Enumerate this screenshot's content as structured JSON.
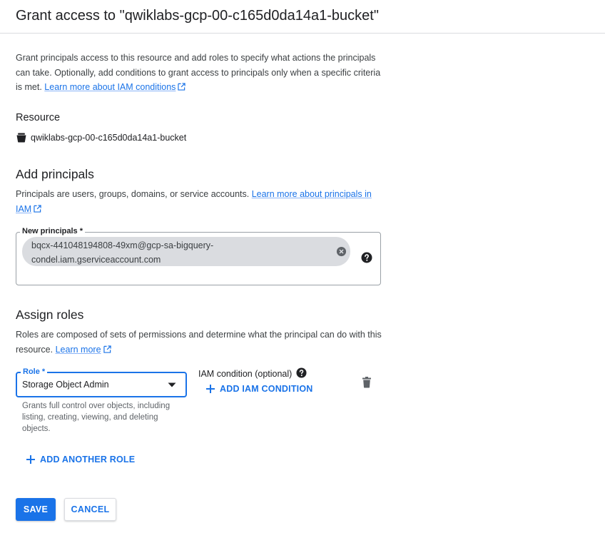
{
  "header": {
    "title": "Grant access to \"qwiklabs-gcp-00-c165d0da14a1-bucket\""
  },
  "intro": {
    "text": "Grant principals access to this resource and add roles to specify what actions the principals can take. Optionally, add conditions to grant access to principals only when a specific criteria is met. ",
    "link_label": "Learn more about IAM conditions"
  },
  "resource": {
    "heading": "Resource",
    "icon": "bucket-icon",
    "name": "qwiklabs-gcp-00-c165d0da14a1-bucket"
  },
  "principals": {
    "title": "Add principals",
    "description": "Principals are users, groups, domains, or service accounts. ",
    "link_label": "Learn more about principals in IAM",
    "field_label": "New principals *",
    "chip_line1": "bqcx-441048194808-49xm@gcp-sa-bigquery-",
    "chip_line2": "condel.iam.gserviceaccount.com"
  },
  "roles": {
    "title": "Assign roles",
    "description": "Roles are composed of sets of permissions and determine what the principal can do with this resource. ",
    "link_label": "Learn more",
    "role_label": "Role *",
    "role_value": "Storage Object Admin",
    "role_hint": "Grants full control over objects, including listing, creating, viewing, and deleting objects.",
    "condition_label": "IAM condition (optional)",
    "add_condition_label": "ADD IAM CONDITION",
    "add_role_label": "ADD ANOTHER ROLE"
  },
  "actions": {
    "save_label": "SAVE",
    "cancel_label": "CANCEL"
  },
  "colors": {
    "accent": "#1a73e8",
    "chip_bg": "#dadce0",
    "border": "#9aa0a6",
    "text": "#202124",
    "secondary_text": "#5f6368"
  }
}
